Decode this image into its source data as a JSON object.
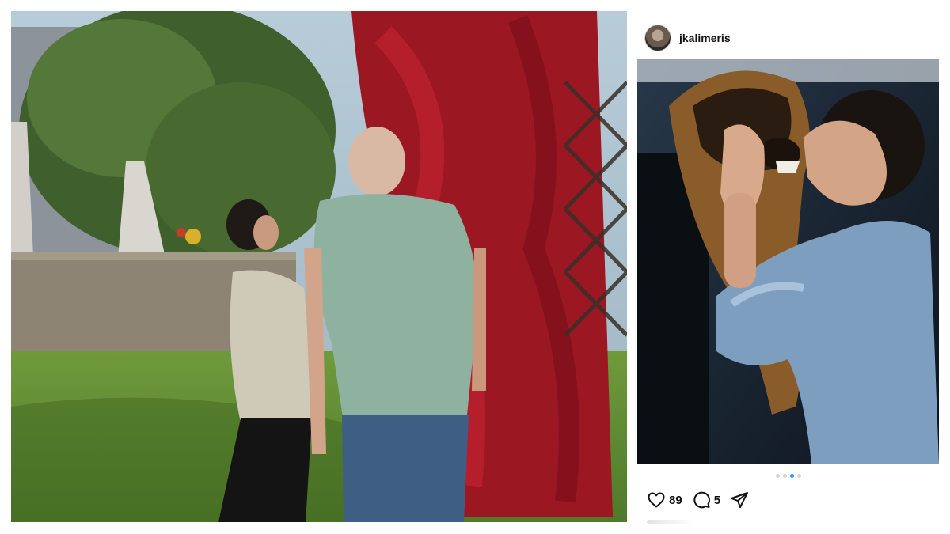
{
  "left_photo": {
    "description_icon": "photo-couple-garden"
  },
  "post": {
    "username": "jkalimeris",
    "avatar_icon": "user-avatar",
    "image_icon": "photo-woman-dog",
    "carousel": {
      "count": 4,
      "active_index": 2,
      "active_color": "#3897f0"
    },
    "likes": "89",
    "comments": "5",
    "icons": {
      "like": "heart-icon",
      "comment": "comment-icon",
      "share": "share-icon"
    }
  }
}
